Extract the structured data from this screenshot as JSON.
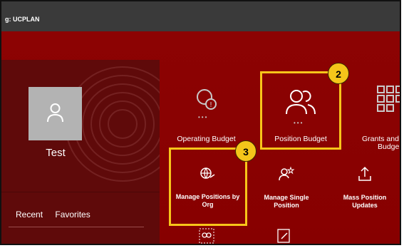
{
  "header": {
    "title": "g: UCPLAN"
  },
  "profile": {
    "name": "Test"
  },
  "tabs": [
    {
      "label": "Recent"
    },
    {
      "label": "Favorites"
    }
  ],
  "tiles": {
    "operating_budget": "Operating Budget",
    "position_budget": "Position Budget",
    "grants_budget_line1": "Grants and",
    "grants_budget_line2": "Budge",
    "manage_positions_line1": "Manage Positions by",
    "manage_positions_line2": "Org",
    "manage_single_line1": "Manage Single",
    "manage_single_line2": "Position",
    "mass_position_line1": "Mass Position",
    "mass_position_line2": "Updates",
    "dots": "•••"
  },
  "callouts": {
    "step2": "2",
    "step3": "3"
  },
  "colors": {
    "background": "#8b0000",
    "highlight": "#f7c51a",
    "topbar": "#3a3a3a"
  }
}
